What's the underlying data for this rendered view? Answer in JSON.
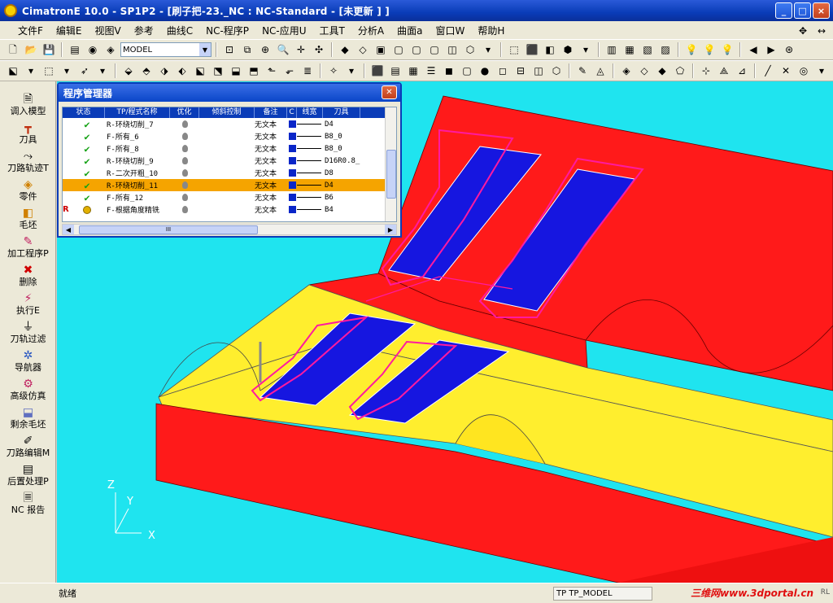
{
  "window": {
    "title": "CimatronE 10.0 - SP1P2 - [刷子把-23._NC : NC-Standard - [未更新 ] ]",
    "buttons": {
      "minimize": "_",
      "maximize": "□",
      "close": "×"
    }
  },
  "menu": {
    "items": [
      "文件F",
      "编辑E",
      "视图V",
      "参考",
      "曲线C",
      "NC-程序P",
      "NC-应用U",
      "工具T",
      "分析A",
      "曲面a",
      "窗口W",
      "帮助H"
    ]
  },
  "toolbar": {
    "model_select": "MODEL"
  },
  "sidebar": {
    "items": [
      {
        "label": "调入模型",
        "icon": "load-model-icon"
      },
      {
        "label": "刀具",
        "icon": "tool-icon"
      },
      {
        "label": "刀路轨迹T",
        "icon": "toolpath-icon"
      },
      {
        "label": "零件",
        "icon": "part-icon"
      },
      {
        "label": "毛坯",
        "icon": "stock-icon"
      },
      {
        "label": "加工程序P",
        "icon": "procedure-icon"
      },
      {
        "label": "删除",
        "icon": "delete-icon"
      },
      {
        "label": "执行E",
        "icon": "execute-icon"
      },
      {
        "label": "刀轨过滤",
        "icon": "filter-icon"
      },
      {
        "label": "导航器",
        "icon": "navigator-icon"
      },
      {
        "label": "高级仿真",
        "icon": "simulation-icon"
      },
      {
        "label": "剩余毛坯",
        "icon": "remaining-stock-icon"
      },
      {
        "label": "刀路编辑M",
        "icon": "edit-icon"
      },
      {
        "label": "后置处理P",
        "icon": "post-process-icon"
      },
      {
        "label": "NC 报告",
        "icon": "report-icon"
      }
    ]
  },
  "program_manager": {
    "title": "程序管理器",
    "columns": [
      "状态",
      "TP/程式名称",
      "优化",
      "倾斜控制",
      "备注",
      "C",
      "线宽",
      "刀具"
    ],
    "rows": [
      {
        "flag": "",
        "status": "ok",
        "name": "R-环绕切削_7",
        "note": "无文本",
        "tool": "D4",
        "selected": false
      },
      {
        "flag": "",
        "status": "ok",
        "name": "F-所有_6",
        "note": "无文本",
        "tool": "B8_0",
        "selected": false
      },
      {
        "flag": "",
        "status": "ok",
        "name": "F-所有_8",
        "note": "无文本",
        "tool": "B8_0",
        "selected": false
      },
      {
        "flag": "",
        "status": "ok",
        "name": "R-环绕切削_9",
        "note": "无文本",
        "tool": "D16R0.8_",
        "selected": false
      },
      {
        "flag": "",
        "status": "ok",
        "name": "R-二次开粗_10",
        "note": "无文本",
        "tool": "D8",
        "selected": false
      },
      {
        "flag": "",
        "status": "ok",
        "name": "R-环绕切削_11",
        "note": "无文本",
        "tool": "D4",
        "selected": true
      },
      {
        "flag": "",
        "status": "ok",
        "name": "F-所有_12",
        "note": "无文本",
        "tool": "B6",
        "selected": false
      },
      {
        "flag": "R",
        "status": "warn",
        "name": "F-根据角度精铣",
        "note": "无文本",
        "tool": "B4",
        "selected": false
      }
    ],
    "hscroll_grip": "III"
  },
  "axes": {
    "z": "Z",
    "y": "Y",
    "x": "X"
  },
  "status": {
    "left": "就绪",
    "tp_model": "TP  TP_MODEL",
    "watermark": "三维网www.3dportal.cn",
    "right": "RL"
  },
  "colors": {
    "viewport_bg": "#1fe4ef",
    "model_red": "#ff1a1a",
    "model_yellow": "#ffee2e",
    "pocket_blue": "#1616e0",
    "toolpath_magenta": "#ff1aa0"
  }
}
